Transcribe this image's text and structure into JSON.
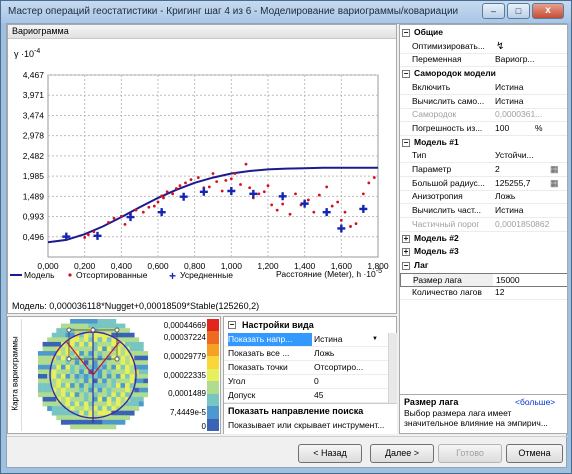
{
  "window": {
    "title": "Мастер операций геостатистики - Кригинг шаг 4 из 6 - Моделирование вариограммы/ковариации",
    "min": "–",
    "max": "□",
    "close": "x"
  },
  "variogram": {
    "panel_title": "Вариограмма",
    "y_unit": "γ ·10",
    "y_exp": "-4",
    "x_label": "Расстояние (Meter), h ·10",
    "x_exp": "-5",
    "model_text": "Модель: 0,000036118*Nugget+0,00018509*Stable(125260,2)",
    "legend": {
      "model": "Модель",
      "sorted": "Отсортированные",
      "averaged": "Усредненные"
    }
  },
  "chart_data": {
    "type": "scatter",
    "title": "Вариограмма",
    "xlabel": "Расстояние (Meter), h ·10-5",
    "ylabel": "γ ·10-4",
    "xlim": [
      0,
      1.8
    ],
    "ylim": [
      0,
      4.467
    ],
    "x_ticks": [
      "0,000",
      "0,200",
      "0,400",
      "0,600",
      "0,800",
      "1,000",
      "1,200",
      "1,400",
      "1,600",
      "1,800"
    ],
    "y_ticks": [
      "0,496",
      "0,993",
      "1,489",
      "1,985",
      "2,482",
      "2,978",
      "3,474",
      "3,971",
      "4,467"
    ],
    "grid": true,
    "legend_position": "bottom",
    "series": [
      {
        "name": "Модель",
        "kind": "line",
        "x": [
          0,
          0.1,
          0.2,
          0.3,
          0.4,
          0.5,
          0.6,
          0.7,
          0.8,
          0.9,
          1.0,
          1.1,
          1.2,
          1.3,
          1.4,
          1.5,
          1.6,
          1.7,
          1.8
        ],
        "y": [
          0.36,
          0.42,
          0.56,
          0.75,
          0.98,
          1.22,
          1.45,
          1.65,
          1.82,
          1.95,
          2.05,
          2.11,
          2.15,
          2.17,
          2.18,
          2.19,
          2.19,
          2.19,
          2.19
        ]
      },
      {
        "name": "Отсортированные",
        "kind": "points",
        "x": [
          0.2,
          0.22,
          0.25,
          0.33,
          0.36,
          0.4,
          0.42,
          0.45,
          0.48,
          0.52,
          0.55,
          0.58,
          0.6,
          0.62,
          0.63,
          0.65,
          0.68,
          0.7,
          0.72,
          0.75,
          0.78,
          0.82,
          0.85,
          0.88,
          0.9,
          0.92,
          0.95,
          0.97,
          1.0,
          1.02,
          1.05,
          1.08,
          1.1,
          1.12,
          1.15,
          1.18,
          1.2,
          1.22,
          1.25,
          1.28,
          1.32,
          1.35,
          1.38,
          1.42,
          1.45,
          1.48,
          1.52,
          1.55,
          1.58,
          1.6,
          1.62,
          1.65,
          1.68,
          1.72,
          1.75,
          1.78
        ],
        "y": [
          0.48,
          0.55,
          0.62,
          0.85,
          0.95,
          1.0,
          0.8,
          1.05,
          1.15,
          1.1,
          1.22,
          1.25,
          1.35,
          1.5,
          1.45,
          1.6,
          1.55,
          1.68,
          1.75,
          1.82,
          1.9,
          1.95,
          1.7,
          1.72,
          2.05,
          1.85,
          1.62,
          1.88,
          1.92,
          2.05,
          1.78,
          2.28,
          1.7,
          1.45,
          1.55,
          1.6,
          1.75,
          1.28,
          1.15,
          1.3,
          1.05,
          1.55,
          1.28,
          1.4,
          1.1,
          1.52,
          1.72,
          1.25,
          1.35,
          0.9,
          1.1,
          0.75,
          0.82,
          1.55,
          1.82,
          1.95
        ]
      },
      {
        "name": "Усредненные",
        "kind": "plus",
        "x": [
          0.1,
          0.27,
          0.45,
          0.62,
          0.74,
          0.85,
          1.0,
          1.12,
          1.28,
          1.4,
          1.52,
          1.6,
          1.72
        ],
        "y": [
          0.5,
          0.52,
          0.98,
          1.1,
          1.48,
          1.6,
          1.62,
          1.55,
          1.49,
          1.31,
          1.1,
          0.7,
          1.18
        ]
      }
    ]
  },
  "map": {
    "axis_label": "Карта вариограммы",
    "scale": [
      "0,00044669",
      "0,00037224",
      "0,00029779",
      "0,00022335",
      "0,0001489",
      "7,4449e-5",
      "0"
    ],
    "colors": [
      "#e3261d",
      "#ee6a20",
      "#f6a123",
      "#fbd63a",
      "#e7ef5a",
      "#b0dc8e",
      "#79c5c2",
      "#4c98cf",
      "#3a62b6"
    ]
  },
  "view_settings": {
    "header": "Настройки вида",
    "rows": [
      {
        "k": "Показать напр...",
        "v": "Истина"
      },
      {
        "k": "Показать все ...",
        "v": "Ложь"
      },
      {
        "k": "Показать точки",
        "v": "Отсортиро..."
      },
      {
        "k": "Угол",
        "v": "0"
      },
      {
        "k": "Допуск",
        "v": "45"
      }
    ],
    "desc_title": "Показать направление поиска",
    "desc_text": "Показывает или скрывает инструмент..."
  },
  "properties": {
    "general": "Общие",
    "optimize": "Оптимизировать...",
    "variable": "Переменная",
    "variable_v": "Вариогр...",
    "nugget": "Самородок модели",
    "enable": "Включить",
    "enable_v": "Истина",
    "calc": "Вычислить само...",
    "calc_v": "Истина",
    "nug": "Самородок",
    "nug_v": "0,0000361...",
    "err": "Погрешность из...",
    "err_v": "100",
    "err_u": "%",
    "model1": "Модель #1",
    "type": "Тип",
    "type_v": "Устойчи...",
    "param": "Параметр",
    "param_v": "2",
    "radius": "Большой радиус...",
    "radius_v": "125255,7",
    "aniso": "Анизотропия",
    "aniso_v": "Ложь",
    "partcalc": "Вычислить част...",
    "partcalc_v": "Истина",
    "partsill": "Частичный порог",
    "partsill_v": "0,0001850862",
    "model2": "Модель #2",
    "model3": "Модель #3",
    "lag": "Лаг",
    "lagsize": "Размер лага",
    "lagsize_v": "15000",
    "lagcount": "Количество лагов",
    "lagcount_v": "12"
  },
  "help": {
    "title": "Размер лага",
    "more": "<больше>",
    "text": "Выбор размера лага имеет значительное влияние на эмпирич..."
  },
  "buttons": {
    "back": "< Назад",
    "next": "Далее >",
    "done": "Готово",
    "cancel": "Отмена"
  }
}
